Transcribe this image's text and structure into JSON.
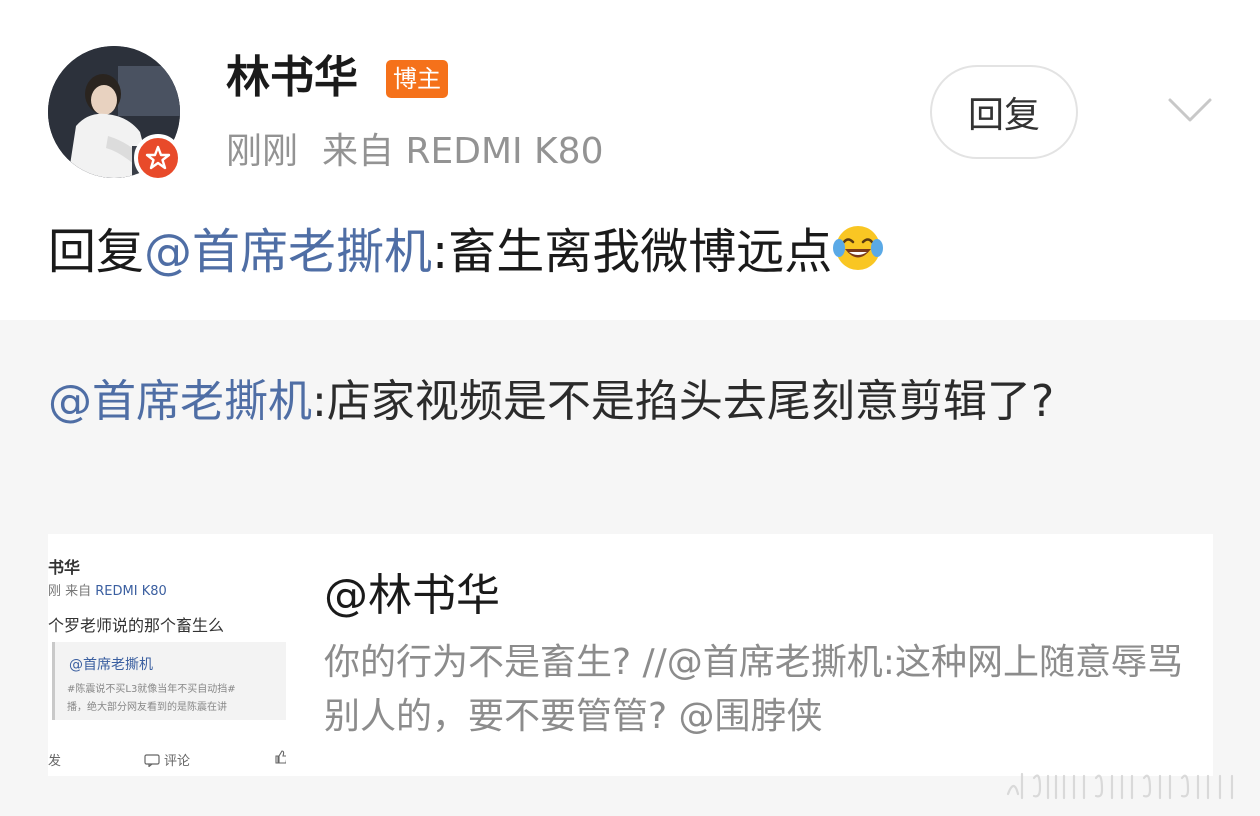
{
  "header": {
    "username": "林书华",
    "user_badge": "博主",
    "time": "刚刚",
    "source": "来自 REDMI K80",
    "reply_button": "回复"
  },
  "post": {
    "prefix": "回复",
    "mention": "@首席老撕机",
    "text": ":畜生离我微博远点",
    "emoji": "laugh-cry-emoji"
  },
  "quoted": {
    "mention": "@首席老撕机",
    "text": ":店家视频是不是掐头去尾刻意剪辑了?"
  },
  "card": {
    "title": "@林书华",
    "description": "你的行为不是畜生? //@首席老撕机:这种网上随意辱骂别人的，要不要管管? @围脖侠",
    "thumbnail": {
      "name": "书华",
      "meta_prefix": "刚 来自 ",
      "meta_device": "REDMI K80",
      "body": "个罗老师说的那个畜生么",
      "quote_title": "@首席老撕机",
      "quote_line1": "#陈震说不买L3就像当年不买自动挡#",
      "quote_line2": "播，绝大部分网友看到的是陈震在讲",
      "action_repost": "发",
      "action_comment": "评论"
    }
  },
  "colors": {
    "mention": "#4f6ea5",
    "badge": "#f5711a",
    "meta_gray": "#939393",
    "quote_bg": "#f6f6f6"
  }
}
